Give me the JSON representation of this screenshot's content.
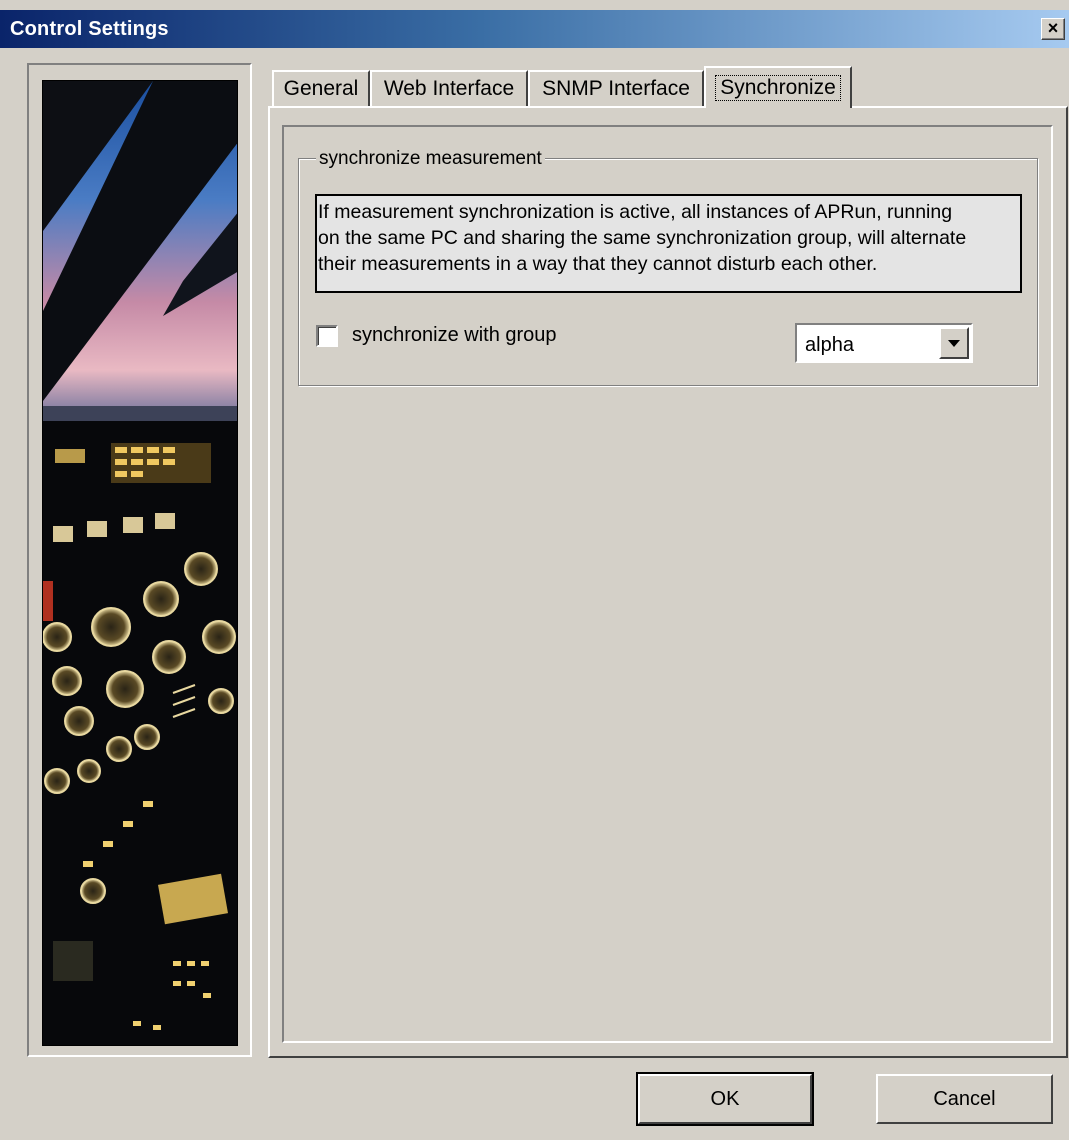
{
  "window": {
    "title": "Control Settings",
    "close_glyph": "×"
  },
  "tabs": [
    {
      "label": "General"
    },
    {
      "label": "Web Interface"
    },
    {
      "label": "SNMP Interface"
    },
    {
      "label": "Synchronize"
    }
  ],
  "active_tab": "Synchronize",
  "synchronize": {
    "group_title": "synchronize measurement",
    "info_text": "If measurement synchronization is active, all instances of APRun, running\non the same PC and sharing the same synchronization group, will alternate\ntheir measurements in a way that they cannot disturb each other.",
    "checkbox_label": "synchronize with group",
    "checkbox_checked": false,
    "group_select_value": "alpha"
  },
  "buttons": {
    "ok": "OK",
    "cancel": "Cancel"
  },
  "side_image": {
    "subject": "aircraft cockpit at dusk"
  },
  "colors": {
    "titlebar_start": "#0a246a",
    "titlebar_end": "#a6caf0",
    "face": "#d4d0c8"
  }
}
